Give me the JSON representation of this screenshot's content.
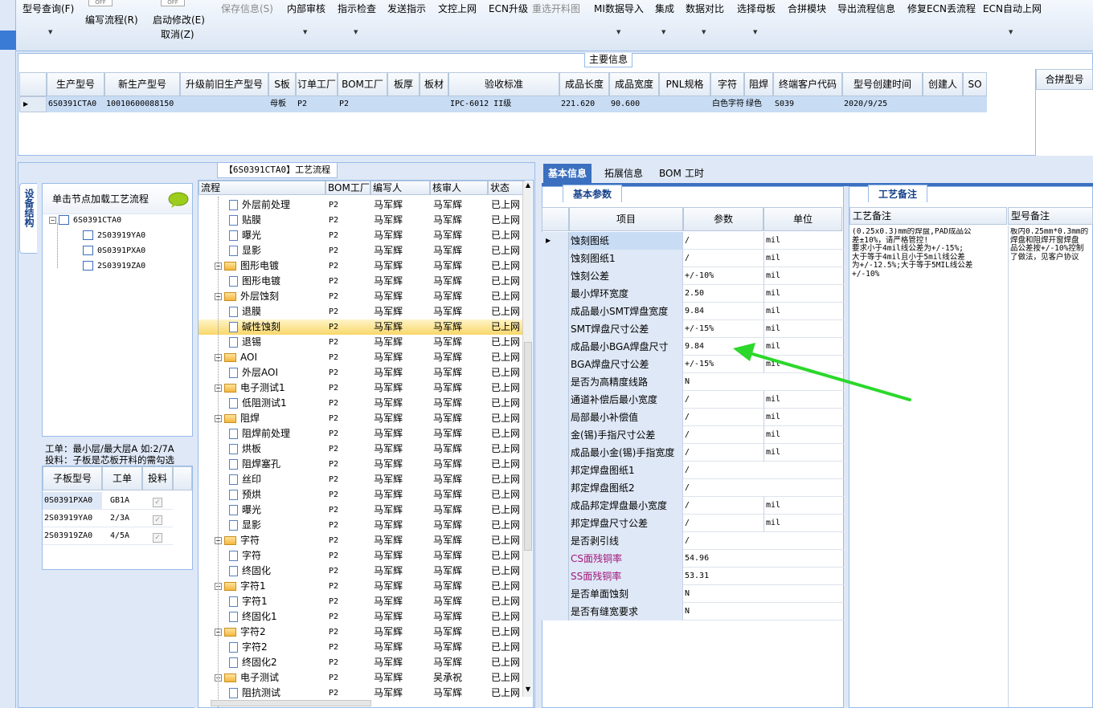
{
  "toolbar": {
    "model_query": "型号查询(F)",
    "compile_flow": "编写流程(R)",
    "start_modify": "启动修改(E)",
    "cancel": "取消(Z)",
    "switch1": "OFF",
    "switch2": "OFF",
    "save_info": "保存信息(S)",
    "internal_review": "内部审核",
    "instruction_check": "指示检查",
    "send_instruction": "发送指示",
    "doc_control_upload": "文控上网",
    "ecn_upgrade": "ECN升级",
    "reselect_material": "重选开料图",
    "mi_import": "MI数据导入",
    "integrate": "集成",
    "data_compare": "数据对比",
    "select_mother": "选择母板",
    "panel_module": "合拼模块",
    "export_flow": "导出流程信息",
    "repair_ecn": "修复ECN丢流程",
    "ecn_auto_upload": "ECN自动上网"
  },
  "main_info": {
    "title": "主要信息",
    "columns": [
      "生产型号",
      "新生产型号",
      "升级前旧生产型号",
      "S板",
      "订单工厂",
      "BOM工厂",
      "板厚",
      "板材",
      "验收标准",
      "成品长度",
      "成品宽度",
      "PNL规格",
      "字符",
      "阻焊",
      "终端客户代码",
      "型号创建时间",
      "创建人",
      "SO"
    ],
    "row": [
      "6S0391CTA0",
      "10010600088150",
      "",
      "母板",
      "P2",
      "P2",
      "",
      "",
      "IPC-6012 II级",
      "221.620",
      "90.600",
      "",
      "白色字符",
      "绿色",
      "S039",
      "2020/9/25",
      "",
      ""
    ],
    "panel_col": "合拼型号"
  },
  "workflow": {
    "title": "【6S0391CTA0】工艺流程",
    "side_tab": "设备结构",
    "tree_header": "单击节点加载工艺流程",
    "tree": [
      "6S0391CTA0",
      "2S03919YA0",
      "0S0391PXA0",
      "2S03919ZA0"
    ],
    "note1": "工单：最小层/最大层A 如:2/7A",
    "note2": "投料：子板是芯板开料的需勾选",
    "sub_columns": [
      "子板型号",
      "工单",
      "投料"
    ],
    "sub_rows": [
      [
        "0S0391PXA0",
        "GB1A"
      ],
      [
        "2S03919YA0",
        "2/3A"
      ],
      [
        "2S03919ZA0",
        "4/5A"
      ]
    ],
    "columns": [
      "流程",
      "BOM工厂",
      "编写人",
      "核审人",
      "状态"
    ],
    "rows": [
      {
        "name": "外层前处理",
        "folder": false,
        "factory": "P2",
        "writer": "马军辉",
        "reviewer": "马军辉",
        "status": "已上网"
      },
      {
        "name": "贴膜",
        "folder": false,
        "factory": "P2",
        "writer": "马军辉",
        "reviewer": "马军辉",
        "status": "已上网"
      },
      {
        "name": "曝光",
        "folder": false,
        "factory": "P2",
        "writer": "马军辉",
        "reviewer": "马军辉",
        "status": "已上网"
      },
      {
        "name": "显影",
        "folder": false,
        "factory": "P2",
        "writer": "马军辉",
        "reviewer": "马军辉",
        "status": "已上网"
      },
      {
        "name": "图形电镀",
        "folder": true,
        "factory": "P2",
        "writer": "马军辉",
        "reviewer": "马军辉",
        "status": "已上网"
      },
      {
        "name": "图形电镀",
        "folder": false,
        "factory": "P2",
        "writer": "马军辉",
        "reviewer": "马军辉",
        "status": "已上网"
      },
      {
        "name": "外层蚀刻",
        "folder": true,
        "factory": "P2",
        "writer": "马军辉",
        "reviewer": "马军辉",
        "status": "已上网"
      },
      {
        "name": "退膜",
        "folder": false,
        "factory": "P2",
        "writer": "马军辉",
        "reviewer": "马军辉",
        "status": "已上网"
      },
      {
        "name": "碱性蚀刻",
        "folder": false,
        "factory": "P2",
        "writer": "马军辉",
        "reviewer": "马军辉",
        "status": "已上网",
        "selected": true
      },
      {
        "name": "退锡",
        "folder": false,
        "factory": "P2",
        "writer": "马军辉",
        "reviewer": "马军辉",
        "status": "已上网"
      },
      {
        "name": "AOI",
        "folder": true,
        "factory": "P2",
        "writer": "马军辉",
        "reviewer": "马军辉",
        "status": "已上网"
      },
      {
        "name": "外层AOI",
        "folder": false,
        "factory": "P2",
        "writer": "马军辉",
        "reviewer": "马军辉",
        "status": "已上网"
      },
      {
        "name": "电子测试1",
        "folder": true,
        "factory": "P2",
        "writer": "马军辉",
        "reviewer": "马军辉",
        "status": "已上网"
      },
      {
        "name": "低阻测试1",
        "folder": false,
        "factory": "P2",
        "writer": "马军辉",
        "reviewer": "马军辉",
        "status": "已上网"
      },
      {
        "name": "阻焊",
        "folder": true,
        "factory": "P2",
        "writer": "马军辉",
        "reviewer": "马军辉",
        "status": "已上网"
      },
      {
        "name": "阻焊前处理",
        "folder": false,
        "factory": "P2",
        "writer": "马军辉",
        "reviewer": "马军辉",
        "status": "已上网"
      },
      {
        "name": "烘板",
        "folder": false,
        "factory": "P2",
        "writer": "马军辉",
        "reviewer": "马军辉",
        "status": "已上网"
      },
      {
        "name": "阻焊塞孔",
        "folder": false,
        "factory": "P2",
        "writer": "马军辉",
        "reviewer": "马军辉",
        "status": "已上网"
      },
      {
        "name": "丝印",
        "folder": false,
        "factory": "P2",
        "writer": "马军辉",
        "reviewer": "马军辉",
        "status": "已上网"
      },
      {
        "name": "预烘",
        "folder": false,
        "factory": "P2",
        "writer": "马军辉",
        "reviewer": "马军辉",
        "status": "已上网"
      },
      {
        "name": "曝光",
        "folder": false,
        "factory": "P2",
        "writer": "马军辉",
        "reviewer": "马军辉",
        "status": "已上网"
      },
      {
        "name": "显影",
        "folder": false,
        "factory": "P2",
        "writer": "马军辉",
        "reviewer": "马军辉",
        "status": "已上网"
      },
      {
        "name": "字符",
        "folder": true,
        "factory": "P2",
        "writer": "马军辉",
        "reviewer": "马军辉",
        "status": "已上网"
      },
      {
        "name": "字符",
        "folder": false,
        "factory": "P2",
        "writer": "马军辉",
        "reviewer": "马军辉",
        "status": "已上网"
      },
      {
        "name": "终固化",
        "folder": false,
        "factory": "P2",
        "writer": "马军辉",
        "reviewer": "马军辉",
        "status": "已上网"
      },
      {
        "name": "字符1",
        "folder": true,
        "factory": "P2",
        "writer": "马军辉",
        "reviewer": "马军辉",
        "status": "已上网"
      },
      {
        "name": "字符1",
        "folder": false,
        "factory": "P2",
        "writer": "马军辉",
        "reviewer": "马军辉",
        "status": "已上网"
      },
      {
        "name": "终固化1",
        "folder": false,
        "factory": "P2",
        "writer": "马军辉",
        "reviewer": "马军辉",
        "status": "已上网"
      },
      {
        "name": "字符2",
        "folder": true,
        "factory": "P2",
        "writer": "马军辉",
        "reviewer": "马军辉",
        "status": "已上网"
      },
      {
        "name": "字符2",
        "folder": false,
        "factory": "P2",
        "writer": "马军辉",
        "reviewer": "马军辉",
        "status": "已上网"
      },
      {
        "name": "终固化2",
        "folder": false,
        "factory": "P2",
        "writer": "马军辉",
        "reviewer": "马军辉",
        "status": "已上网"
      },
      {
        "name": "电子测试",
        "folder": true,
        "factory": "P2",
        "writer": "马军辉",
        "reviewer": "吴承祝",
        "status": "已上网"
      },
      {
        "name": "阻抗测试",
        "folder": false,
        "factory": "P2",
        "writer": "马军辉",
        "reviewer": "马军辉",
        "status": "已上网"
      }
    ]
  },
  "right": {
    "tabs": [
      "基本信息",
      "拓展信息",
      "BOM",
      "工时"
    ],
    "basic_title": "基本参数",
    "param_columns": [
      "项目",
      "参数",
      "单位"
    ],
    "params": [
      {
        "item": "蚀刻图纸",
        "value": "/",
        "unit": "mil",
        "selected": true
      },
      {
        "item": "蚀刻图纸1",
        "value": "/",
        "unit": "mil"
      },
      {
        "item": "蚀刻公差",
        "value": "+/-10%",
        "unit": "mil"
      },
      {
        "item": "最小焊环宽度",
        "value": "2.50",
        "unit": "mil"
      },
      {
        "item": "成品最小SMT焊盘宽度",
        "value": "9.84",
        "unit": "mil"
      },
      {
        "item": "SMT焊盘尺寸公差",
        "value": "+/-15%",
        "unit": "mil"
      },
      {
        "item": "成品最小BGA焊盘尺寸",
        "value": "9.84",
        "unit": "mil"
      },
      {
        "item": "BGA焊盘尺寸公差",
        "value": "+/-15%",
        "unit": "mil"
      },
      {
        "item": "是否为高精度线路",
        "value": "N",
        "unit": ""
      },
      {
        "item": "通道补偿后最小宽度",
        "value": "/",
        "unit": "mil"
      },
      {
        "item": "局部最小补偿值",
        "value": "/",
        "unit": "mil"
      },
      {
        "item": "金(锡)手指尺寸公差",
        "value": "/",
        "unit": "mil"
      },
      {
        "item": "成品最小金(锡)手指宽度",
        "value": "/",
        "unit": "mil"
      },
      {
        "item": "邦定焊盘图纸1",
        "value": "/",
        "unit": ""
      },
      {
        "item": "邦定焊盘图纸2",
        "value": "/",
        "unit": ""
      },
      {
        "item": "成品邦定焊盘最小宽度",
        "value": "/",
        "unit": "mil"
      },
      {
        "item": "邦定焊盘尺寸公差",
        "value": "/",
        "unit": "mil"
      },
      {
        "item": "是否剥引线",
        "value": "/",
        "unit": ""
      },
      {
        "item": "CS面残铜率",
        "value": "54.96",
        "unit": "",
        "highlight": true
      },
      {
        "item": "SS面残铜率",
        "value": "53.31",
        "unit": "",
        "highlight": true
      },
      {
        "item": "是否单面蚀刻",
        "value": "N",
        "unit": ""
      },
      {
        "item": "是否有缝宽要求",
        "value": "N",
        "unit": ""
      }
    ],
    "notes_title": "工艺备注",
    "notes_cols": [
      "工艺备注",
      "型号备注"
    ],
    "process_note": "(0.25x0.3)mm的焊盘,PAD成品公\n差±10%，请严格管控!\n要求小于4mil线公差为+/-15%;\n大于等于4mil且小于5mil线公差\n为+/-12.5%;大于等于5MIL线公差\n+/-10%",
    "model_note": "板内0.25mm*0.3mm的\n焊盘和阻焊开窗焊盘\n品公差按+/-10%控制\n了做法，见客户协议",
    "colors": {
      "highlight": "#a0157a",
      "arrow": "#2bd82b"
    }
  }
}
